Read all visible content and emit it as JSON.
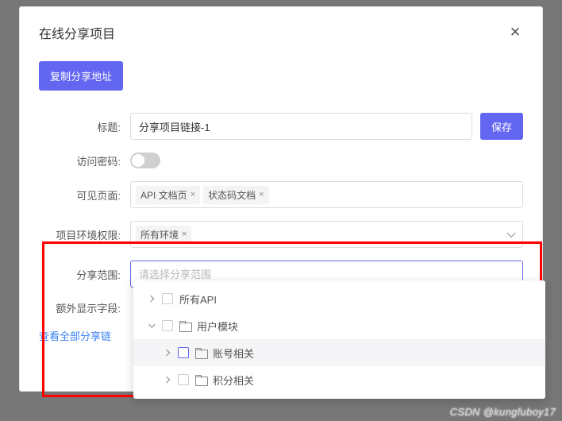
{
  "modal": {
    "title": "在线分享项目",
    "copy_btn": "复制分享地址",
    "save_btn": "保存"
  },
  "form": {
    "title_label": "标题:",
    "title_value": "分享项目链接-1",
    "password_label": "访问密码:",
    "pages_label": "可见页面:",
    "pages_tags": [
      "API 文档页",
      "状态码文档"
    ],
    "env_label": "项目环境权限:",
    "env_tags": [
      "所有环境"
    ],
    "scope_label": "分享范围:",
    "scope_placeholder": "请选择分享范围",
    "extra_label": "额外显示字段:",
    "view_all_link": "查看全部分享链"
  },
  "tree": {
    "items": [
      {
        "label": "所有API",
        "expand": "right",
        "level": 0,
        "folder": false,
        "chk": "plain"
      },
      {
        "label": "用户模块",
        "expand": "down",
        "level": 0,
        "folder": true,
        "chk": "plain"
      },
      {
        "label": "账号相关",
        "expand": "right",
        "level": 1,
        "folder": true,
        "chk": "blue",
        "hover": true
      },
      {
        "label": "积分相关",
        "expand": "right",
        "level": 1,
        "folder": true,
        "chk": "plain"
      }
    ]
  },
  "watermark": "CSDN @kungfuboy17"
}
